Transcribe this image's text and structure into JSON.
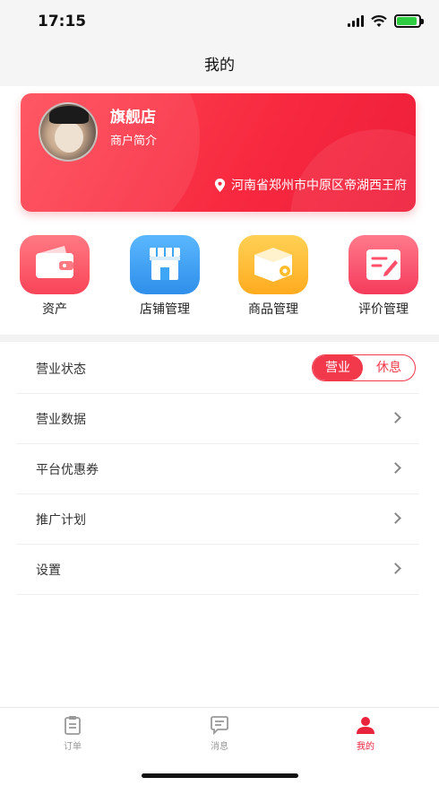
{
  "status_bar": {
    "time": "17:15",
    "battery_level": 0.9
  },
  "nav": {
    "title": "我的"
  },
  "merchant": {
    "name": "旗舰店",
    "intro": "商户简介",
    "address": "河南省郑州市中原区帝湖西王府",
    "card_color": "#f7283f"
  },
  "quick_actions": [
    {
      "label": "资产",
      "icon": "wallet-icon",
      "color": "#ff5a68"
    },
    {
      "label": "店铺管理",
      "icon": "store-icon",
      "color": "#3ea6f5"
    },
    {
      "label": "商品管理",
      "icon": "box-gear-icon",
      "color": "#ffbd2e"
    },
    {
      "label": "评价管理",
      "icon": "edit-note-icon",
      "color": "#ff4f6a"
    }
  ],
  "menu": {
    "business_status": {
      "label": "营业状态",
      "on_label": "营业",
      "off_label": "休息",
      "selected": "营业"
    },
    "items": [
      {
        "label": "营业数据"
      },
      {
        "label": "平台优惠券"
      },
      {
        "label": "推广计划"
      },
      {
        "label": "设置"
      }
    ]
  },
  "tabs": [
    {
      "label": "订单",
      "icon": "order-list-icon",
      "active": false
    },
    {
      "label": "消息",
      "icon": "message-icon",
      "active": false
    },
    {
      "label": "我的",
      "icon": "user-icon",
      "active": true
    }
  ],
  "colors": {
    "accent": "#e8233c",
    "inactive": "#999999"
  }
}
